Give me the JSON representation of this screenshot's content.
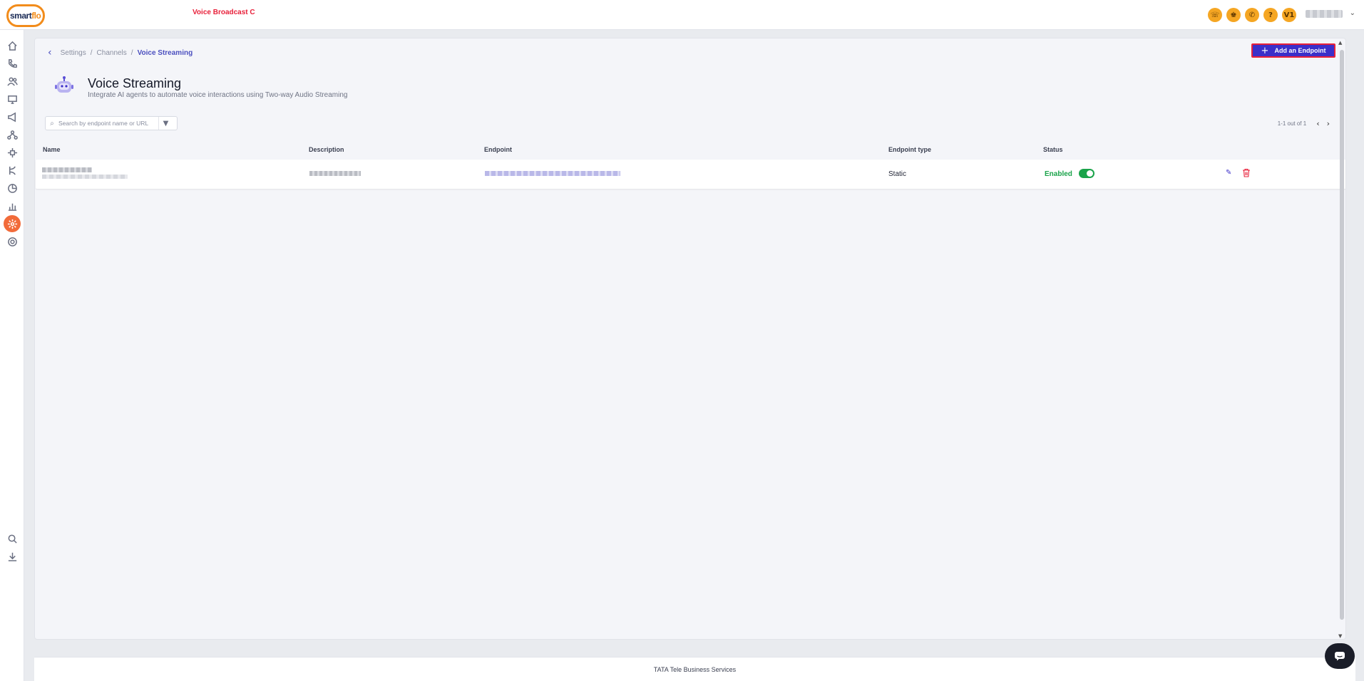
{
  "app": {
    "logo_text_a": "smart",
    "logo_text_b": "flo",
    "top_title": "Voice Broadcast C",
    "avatar_initials": "V1"
  },
  "icons": {
    "sidebar": [
      "home-icon",
      "phone-icon",
      "contacts-icon",
      "monitor-icon",
      "campaign-icon",
      "network-icon",
      "plugin-icon",
      "routing-icon",
      "pie-chart-icon",
      "bar-chart-icon",
      "ai-hub-icon",
      "settings-icon",
      "search-icon",
      "download-icon"
    ],
    "topbar": [
      "call-icon",
      "agent-icon",
      "dialer-icon",
      "help-icon"
    ]
  },
  "breadcrumb": {
    "items": [
      "Settings",
      "Channels"
    ],
    "current": "Voice Streaming"
  },
  "actions": {
    "add_endpoint": "Add an Endpoint"
  },
  "page": {
    "title": "Voice Streaming",
    "subtitle": "Integrate AI agents to automate voice interactions using Two-way Audio Streaming"
  },
  "search": {
    "placeholder": "Search by endpoint name or URL"
  },
  "pagination": {
    "text": "1-1 out of 1"
  },
  "table": {
    "columns": [
      "Name",
      "Description",
      "Endpoint",
      "Endpoint type",
      "Status"
    ],
    "rows": [
      {
        "endpoint_type": "Static",
        "status": "Enabled",
        "enabled": true
      }
    ]
  },
  "footer": {
    "text": "TATA Tele Business Services"
  },
  "colors": {
    "accent": "#3b2fc9",
    "brand_orange": "#f28c1b",
    "status_green": "#1aa34a",
    "danger": "#e8203a"
  }
}
